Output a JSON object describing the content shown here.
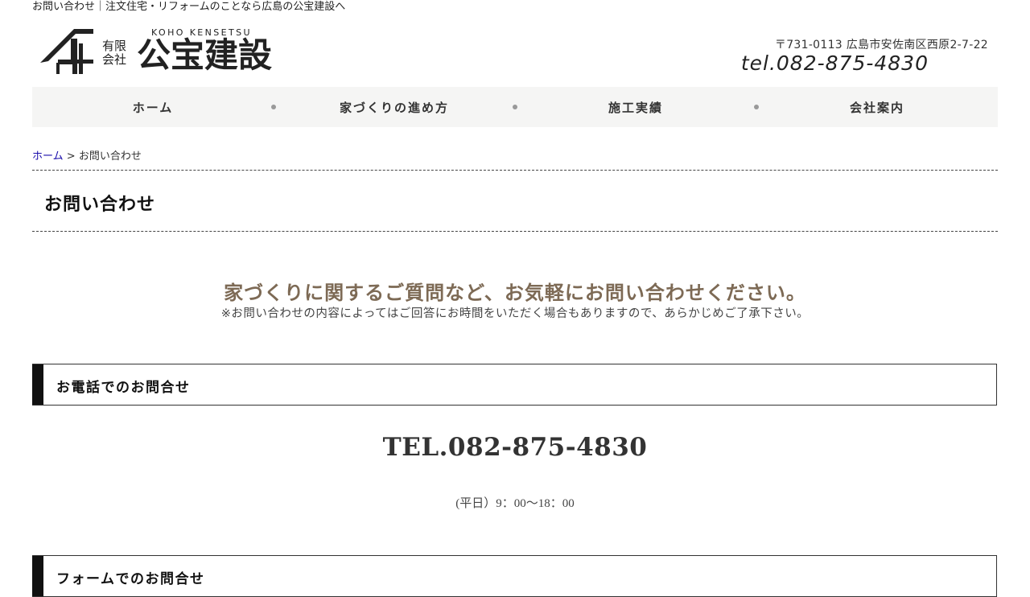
{
  "header": {
    "tagline": "お問い合わせ｜注文住宅・リフォームのことなら広島の公宝建設へ",
    "logo": {
      "roman": "KOHO KENSETSU",
      "company_type_line1": "有限",
      "company_type_line2": "会社",
      "name": "公宝建設"
    },
    "address": "〒731-0113 広島市安佐南区西原2-7-22",
    "tel": "tel.082-875-4830"
  },
  "nav": {
    "items": [
      {
        "label": "ホーム"
      },
      {
        "label": "家づくりの進め方"
      },
      {
        "label": "施工実績"
      },
      {
        "label": "会社案内"
      }
    ]
  },
  "breadcrumb": {
    "home": "ホーム",
    "separator": ">",
    "current": "お問い合わせ"
  },
  "page": {
    "title": "お問い合わせ",
    "lead": "家づくりに関するご質問など、お気軽にお問い合わせください。",
    "note": "※お問い合わせの内容によってはご回答にお時間をいただく場合もありますので、あらかじめご了承下さい。"
  },
  "phone_section": {
    "heading": "お電話でのお問合せ",
    "tel": "TEL.082-875-4830",
    "hours": "(平日）9：00～18：00"
  },
  "form_section": {
    "heading": "フォームでのお問合せ"
  },
  "colors": {
    "lead_text": "#7d6a55",
    "nav_bg": "#f5f5f4",
    "link": "#1a0dab"
  }
}
